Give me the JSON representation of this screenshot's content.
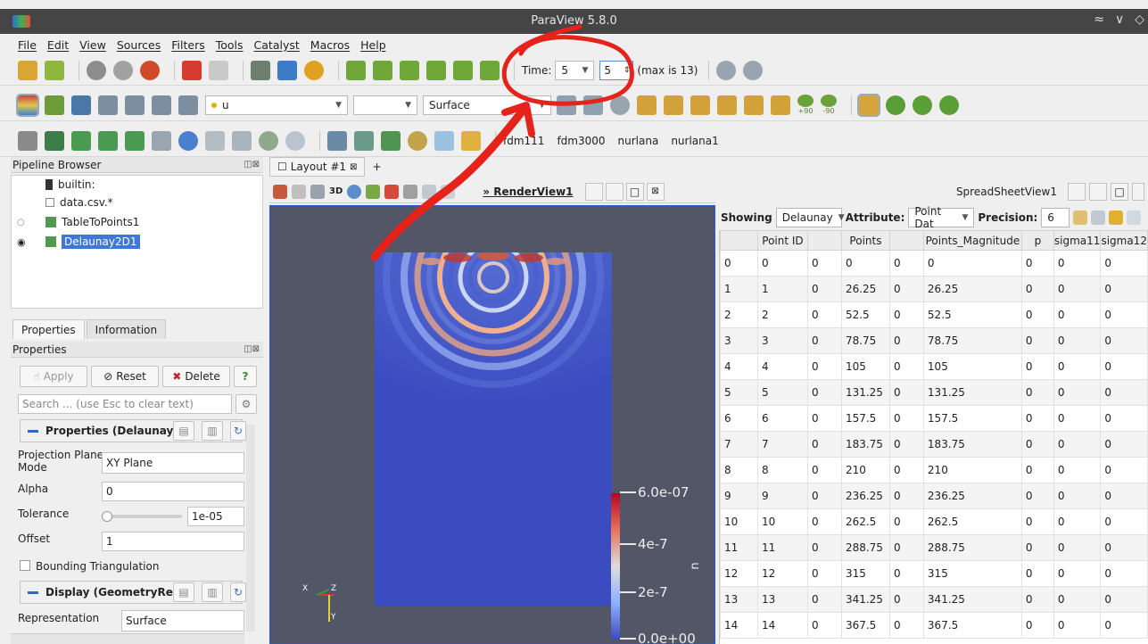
{
  "window": {
    "title": "ParaView 5.8.0",
    "controls": [
      "≈",
      "∨",
      "◇"
    ]
  },
  "menu": [
    "File",
    "Edit",
    "View",
    "Sources",
    "Filters",
    "Tools",
    "Catalyst",
    "Macros",
    "Help"
  ],
  "toolbar_time": {
    "time_label": "Time:",
    "time_value": "5",
    "index_value": "5",
    "max_label": "(max is 13)"
  },
  "toolbar_display": {
    "variable": "u",
    "component": "",
    "representation": "Surface"
  },
  "camera": {
    "rot_pos": "+90",
    "rot_neg": "-90"
  },
  "presets": [
    "fdm111",
    "fdm3000",
    "nurlana",
    "nurlana1"
  ],
  "pipeline": {
    "title": "Pipeline Browser",
    "items": [
      "builtin:",
      "data.csv.*",
      "TableToPoints1",
      "Delaunay2D1"
    ]
  },
  "properties_panel": {
    "tabs": [
      "Properties",
      "Information"
    ],
    "title": "Properties",
    "apply": "Apply",
    "reset": "Reset",
    "delete": "Delete",
    "help": "?",
    "search_placeholder": "Search ... (use Esc to clear text)",
    "section_props": "Properties (Delaunay2",
    "projection_label_1": "Projection Plane",
    "projection_label_2": "Mode",
    "projection_value": "XY Plane",
    "alpha_label": "Alpha",
    "alpha_value": "0",
    "tolerance_label": "Tolerance",
    "tolerance_value": "1e-05",
    "tolerance_fraction": 0.05,
    "offset_label": "Offset",
    "offset_value": "1",
    "bounding_label": "Bounding Triangulation",
    "section_display": "Display (GeometryRep",
    "representation_label": "Representation",
    "representation_value": "Surface"
  },
  "layout": {
    "tab": "Layout #1",
    "plus": "+",
    "render_view": "RenderView1",
    "view_3d": "3D",
    "spreadsheet_view": "SpreadSheetView1"
  },
  "spreadsheet": {
    "showing_label": "Showing",
    "showing_value": "Delaunay",
    "attribute_label": "Attribute:",
    "attribute_value": "Point Dat",
    "precision_label": "Precision:",
    "precision_value": "6",
    "columns": [
      "",
      "Point ID",
      "",
      "Points",
      "",
      "Points_Magnitude",
      "p",
      "sigma11",
      "sigma12"
    ],
    "rows": [
      [
        "0",
        "0",
        "0",
        "0",
        "0",
        "0",
        "0",
        "0",
        "0"
      ],
      [
        "1",
        "1",
        "0",
        "26.25",
        "0",
        "26.25",
        "0",
        "0",
        "0"
      ],
      [
        "2",
        "2",
        "0",
        "52.5",
        "0",
        "52.5",
        "0",
        "0",
        "0"
      ],
      [
        "3",
        "3",
        "0",
        "78.75",
        "0",
        "78.75",
        "0",
        "0",
        "0"
      ],
      [
        "4",
        "4",
        "0",
        "105",
        "0",
        "105",
        "0",
        "0",
        "0"
      ],
      [
        "5",
        "5",
        "0",
        "131.25",
        "0",
        "131.25",
        "0",
        "0",
        "0"
      ],
      [
        "6",
        "6",
        "0",
        "157.5",
        "0",
        "157.5",
        "0",
        "0",
        "0"
      ],
      [
        "7",
        "7",
        "0",
        "183.75",
        "0",
        "183.75",
        "0",
        "0",
        "0"
      ],
      [
        "8",
        "8",
        "0",
        "210",
        "0",
        "210",
        "0",
        "0",
        "0"
      ],
      [
        "9",
        "9",
        "0",
        "236.25",
        "0",
        "236.25",
        "0",
        "0",
        "0"
      ],
      [
        "10",
        "10",
        "0",
        "262.5",
        "0",
        "262.5",
        "0",
        "0",
        "0"
      ],
      [
        "11",
        "11",
        "0",
        "288.75",
        "0",
        "288.75",
        "0",
        "0",
        "0"
      ],
      [
        "12",
        "12",
        "0",
        "315",
        "0",
        "315",
        "0",
        "0",
        "0"
      ],
      [
        "13",
        "13",
        "0",
        "341.25",
        "0",
        "341.25",
        "0",
        "0",
        "0"
      ],
      [
        "14",
        "14",
        "0",
        "367.5",
        "0",
        "367.5",
        "0",
        "0",
        "0"
      ]
    ]
  },
  "color_legend": {
    "labels": [
      "6.0e-07",
      "4e-7",
      "2e-7",
      "0.0e+00"
    ],
    "variable": "u"
  },
  "axes": {
    "x": "X",
    "y": "Y",
    "z": "Z"
  },
  "colors": {
    "titlebar": "#454545",
    "selection": "#3d78d8",
    "render_bg": "#525667",
    "annotation": "#e5231b"
  }
}
